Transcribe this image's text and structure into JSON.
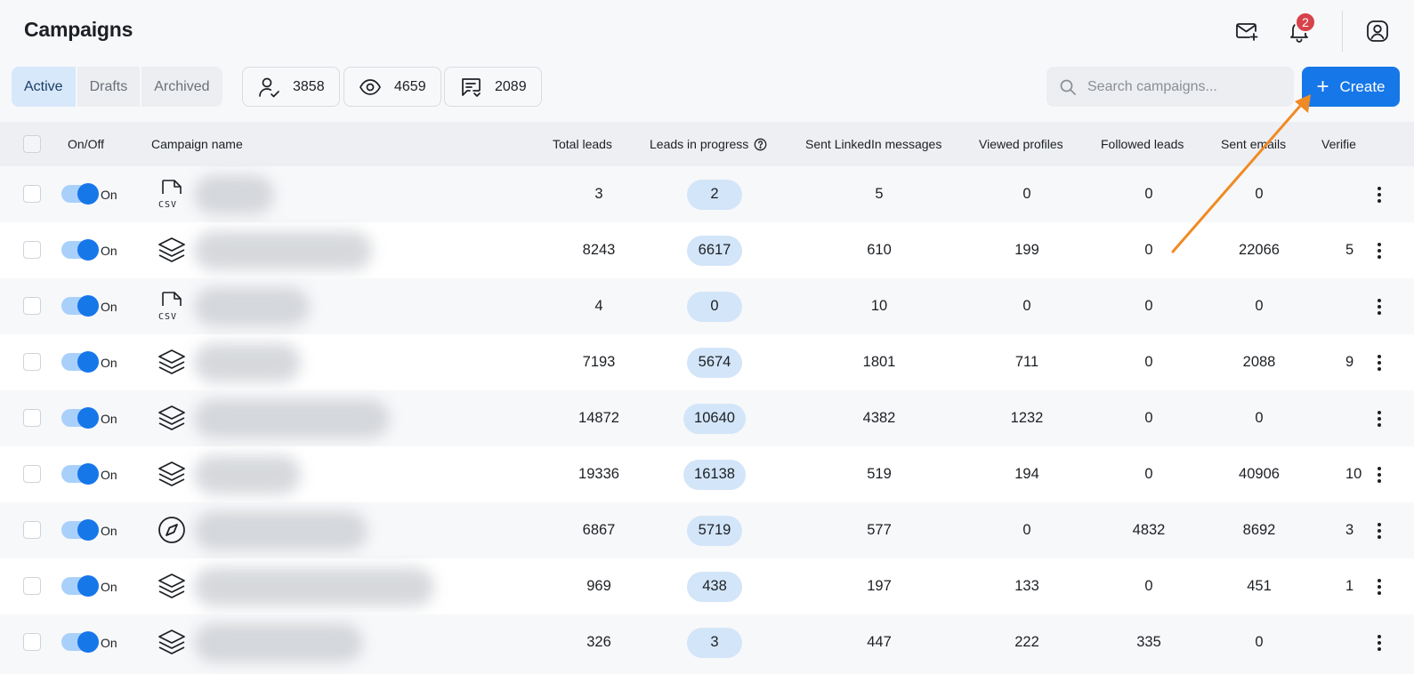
{
  "header": {
    "title": "Campaigns",
    "notification_count": "2"
  },
  "tabs": [
    {
      "label": "Active",
      "active": true
    },
    {
      "label": "Drafts",
      "active": false
    },
    {
      "label": "Archived",
      "active": false
    }
  ],
  "stats": {
    "leads": "3858",
    "views": "4659",
    "messages": "2089"
  },
  "search": {
    "placeholder": "Search campaigns..."
  },
  "create_label": "Create",
  "columns": {
    "onoff": "On/Off",
    "name": "Campaign name",
    "total_leads": "Total leads",
    "leads_in_progress": "Leads in progress",
    "sent_linkedin": "Sent LinkedIn messages",
    "viewed_profiles": "Viewed profiles",
    "followed_leads": "Followed leads",
    "sent_emails": "Sent emails",
    "verified": "Verifie"
  },
  "rows": [
    {
      "on": "On",
      "icon": "csv-icon",
      "total": "3",
      "progress": "2",
      "linkedin": "5",
      "viewed": "0",
      "followed": "0",
      "emails": "0",
      "verified": ""
    },
    {
      "on": "On",
      "icon": "layers-icon",
      "total": "8243",
      "progress": "6617",
      "linkedin": "610",
      "viewed": "199",
      "followed": "0",
      "emails": "22066",
      "verified": "5"
    },
    {
      "on": "On",
      "icon": "csv-icon",
      "total": "4",
      "progress": "0",
      "linkedin": "10",
      "viewed": "0",
      "followed": "0",
      "emails": "0",
      "verified": ""
    },
    {
      "on": "On",
      "icon": "layers-icon",
      "total": "7193",
      "progress": "5674",
      "linkedin": "1801",
      "viewed": "711",
      "followed": "0",
      "emails": "2088",
      "verified": "9"
    },
    {
      "on": "On",
      "icon": "layers-icon",
      "total": "14872",
      "progress": "10640",
      "linkedin": "4382",
      "viewed": "1232",
      "followed": "0",
      "emails": "0",
      "verified": ""
    },
    {
      "on": "On",
      "icon": "layers-icon",
      "total": "19336",
      "progress": "16138",
      "linkedin": "519",
      "viewed": "194",
      "followed": "0",
      "emails": "40906",
      "verified": "10"
    },
    {
      "on": "On",
      "icon": "compass-icon",
      "total": "6867",
      "progress": "5719",
      "linkedin": "577",
      "viewed": "0",
      "followed": "4832",
      "emails": "8692",
      "verified": "3"
    },
    {
      "on": "On",
      "icon": "layers-icon",
      "total": "969",
      "progress": "438",
      "linkedin": "197",
      "viewed": "133",
      "followed": "0",
      "emails": "451",
      "verified": "1"
    },
    {
      "on": "On",
      "icon": "layers-icon",
      "total": "326",
      "progress": "3",
      "linkedin": "447",
      "viewed": "222",
      "followed": "335",
      "emails": "0",
      "verified": ""
    }
  ],
  "colors": {
    "accent": "#1677e8",
    "badge": "#d8424a",
    "pill": "#d3e5f8",
    "annotation_arrow": "#f08a24"
  }
}
